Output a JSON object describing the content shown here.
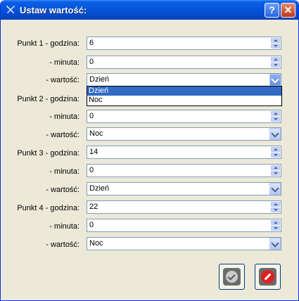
{
  "window": {
    "title": "Ustaw wartość:"
  },
  "titlebar": {
    "help": "?",
    "close": "✕"
  },
  "rows": [
    {
      "label": "Punkt 1 - godzina:",
      "value": "6",
      "kind": "spin"
    },
    {
      "label": "- minuta:",
      "value": "0",
      "kind": "spin"
    },
    {
      "label": "- wartość:",
      "value": "Dzień",
      "kind": "combo"
    },
    {
      "label": "Punkt 2 - godzina:",
      "value": "",
      "kind": "spin"
    },
    {
      "label": "- minuta:",
      "value": "0",
      "kind": "spin"
    },
    {
      "label": "- wartość:",
      "value": "Noc",
      "kind": "combo"
    },
    {
      "label": "Punkt 3 - godzina:",
      "value": "14",
      "kind": "spin"
    },
    {
      "label": "- minuta:",
      "value": "0",
      "kind": "spin"
    },
    {
      "label": "- wartość:",
      "value": "Dzień",
      "kind": "combo"
    },
    {
      "label": "Punkt 4 - godzina:",
      "value": "22",
      "kind": "spin"
    },
    {
      "label": "- minuta:",
      "value": "0",
      "kind": "spin"
    },
    {
      "label": "- wartość:",
      "value": "Noc",
      "kind": "combo"
    }
  ],
  "dropdown": {
    "options": [
      "Dzień",
      "Noc"
    ],
    "selected": "Dzień"
  },
  "buttons": {
    "ok_icon": "checkmark-icon",
    "cancel_icon": "no-entry-icon"
  },
  "colors": {
    "titlebar": "#0653d8",
    "selection": "#316ac5",
    "dialog": "#ece9d8"
  }
}
